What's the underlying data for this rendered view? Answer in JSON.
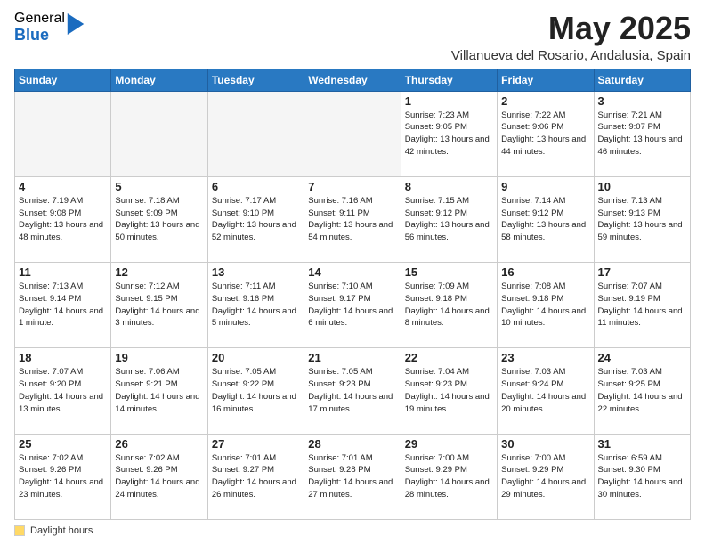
{
  "logo": {
    "general": "General",
    "blue": "Blue"
  },
  "title": "May 2025",
  "subtitle": "Villanueva del Rosario, Andalusia, Spain",
  "footer": {
    "dot_label": "Daylight hours"
  },
  "weekdays": [
    "Sunday",
    "Monday",
    "Tuesday",
    "Wednesday",
    "Thursday",
    "Friday",
    "Saturday"
  ],
  "weeks": [
    [
      {
        "day": "",
        "info": ""
      },
      {
        "day": "",
        "info": ""
      },
      {
        "day": "",
        "info": ""
      },
      {
        "day": "",
        "info": ""
      },
      {
        "day": "1",
        "info": "Sunrise: 7:23 AM\nSunset: 9:05 PM\nDaylight: 13 hours\nand 42 minutes."
      },
      {
        "day": "2",
        "info": "Sunrise: 7:22 AM\nSunset: 9:06 PM\nDaylight: 13 hours\nand 44 minutes."
      },
      {
        "day": "3",
        "info": "Sunrise: 7:21 AM\nSunset: 9:07 PM\nDaylight: 13 hours\nand 46 minutes."
      }
    ],
    [
      {
        "day": "4",
        "info": "Sunrise: 7:19 AM\nSunset: 9:08 PM\nDaylight: 13 hours\nand 48 minutes."
      },
      {
        "day": "5",
        "info": "Sunrise: 7:18 AM\nSunset: 9:09 PM\nDaylight: 13 hours\nand 50 minutes."
      },
      {
        "day": "6",
        "info": "Sunrise: 7:17 AM\nSunset: 9:10 PM\nDaylight: 13 hours\nand 52 minutes."
      },
      {
        "day": "7",
        "info": "Sunrise: 7:16 AM\nSunset: 9:11 PM\nDaylight: 13 hours\nand 54 minutes."
      },
      {
        "day": "8",
        "info": "Sunrise: 7:15 AM\nSunset: 9:12 PM\nDaylight: 13 hours\nand 56 minutes."
      },
      {
        "day": "9",
        "info": "Sunrise: 7:14 AM\nSunset: 9:12 PM\nDaylight: 13 hours\nand 58 minutes."
      },
      {
        "day": "10",
        "info": "Sunrise: 7:13 AM\nSunset: 9:13 PM\nDaylight: 13 hours\nand 59 minutes."
      }
    ],
    [
      {
        "day": "11",
        "info": "Sunrise: 7:13 AM\nSunset: 9:14 PM\nDaylight: 14 hours\nand 1 minute."
      },
      {
        "day": "12",
        "info": "Sunrise: 7:12 AM\nSunset: 9:15 PM\nDaylight: 14 hours\nand 3 minutes."
      },
      {
        "day": "13",
        "info": "Sunrise: 7:11 AM\nSunset: 9:16 PM\nDaylight: 14 hours\nand 5 minutes."
      },
      {
        "day": "14",
        "info": "Sunrise: 7:10 AM\nSunset: 9:17 PM\nDaylight: 14 hours\nand 6 minutes."
      },
      {
        "day": "15",
        "info": "Sunrise: 7:09 AM\nSunset: 9:18 PM\nDaylight: 14 hours\nand 8 minutes."
      },
      {
        "day": "16",
        "info": "Sunrise: 7:08 AM\nSunset: 9:18 PM\nDaylight: 14 hours\nand 10 minutes."
      },
      {
        "day": "17",
        "info": "Sunrise: 7:07 AM\nSunset: 9:19 PM\nDaylight: 14 hours\nand 11 minutes."
      }
    ],
    [
      {
        "day": "18",
        "info": "Sunrise: 7:07 AM\nSunset: 9:20 PM\nDaylight: 14 hours\nand 13 minutes."
      },
      {
        "day": "19",
        "info": "Sunrise: 7:06 AM\nSunset: 9:21 PM\nDaylight: 14 hours\nand 14 minutes."
      },
      {
        "day": "20",
        "info": "Sunrise: 7:05 AM\nSunset: 9:22 PM\nDaylight: 14 hours\nand 16 minutes."
      },
      {
        "day": "21",
        "info": "Sunrise: 7:05 AM\nSunset: 9:23 PM\nDaylight: 14 hours\nand 17 minutes."
      },
      {
        "day": "22",
        "info": "Sunrise: 7:04 AM\nSunset: 9:23 PM\nDaylight: 14 hours\nand 19 minutes."
      },
      {
        "day": "23",
        "info": "Sunrise: 7:03 AM\nSunset: 9:24 PM\nDaylight: 14 hours\nand 20 minutes."
      },
      {
        "day": "24",
        "info": "Sunrise: 7:03 AM\nSunset: 9:25 PM\nDaylight: 14 hours\nand 22 minutes."
      }
    ],
    [
      {
        "day": "25",
        "info": "Sunrise: 7:02 AM\nSunset: 9:26 PM\nDaylight: 14 hours\nand 23 minutes."
      },
      {
        "day": "26",
        "info": "Sunrise: 7:02 AM\nSunset: 9:26 PM\nDaylight: 14 hours\nand 24 minutes."
      },
      {
        "day": "27",
        "info": "Sunrise: 7:01 AM\nSunset: 9:27 PM\nDaylight: 14 hours\nand 26 minutes."
      },
      {
        "day": "28",
        "info": "Sunrise: 7:01 AM\nSunset: 9:28 PM\nDaylight: 14 hours\nand 27 minutes."
      },
      {
        "day": "29",
        "info": "Sunrise: 7:00 AM\nSunset: 9:29 PM\nDaylight: 14 hours\nand 28 minutes."
      },
      {
        "day": "30",
        "info": "Sunrise: 7:00 AM\nSunset: 9:29 PM\nDaylight: 14 hours\nand 29 minutes."
      },
      {
        "day": "31",
        "info": "Sunrise: 6:59 AM\nSunset: 9:30 PM\nDaylight: 14 hours\nand 30 minutes."
      }
    ]
  ]
}
